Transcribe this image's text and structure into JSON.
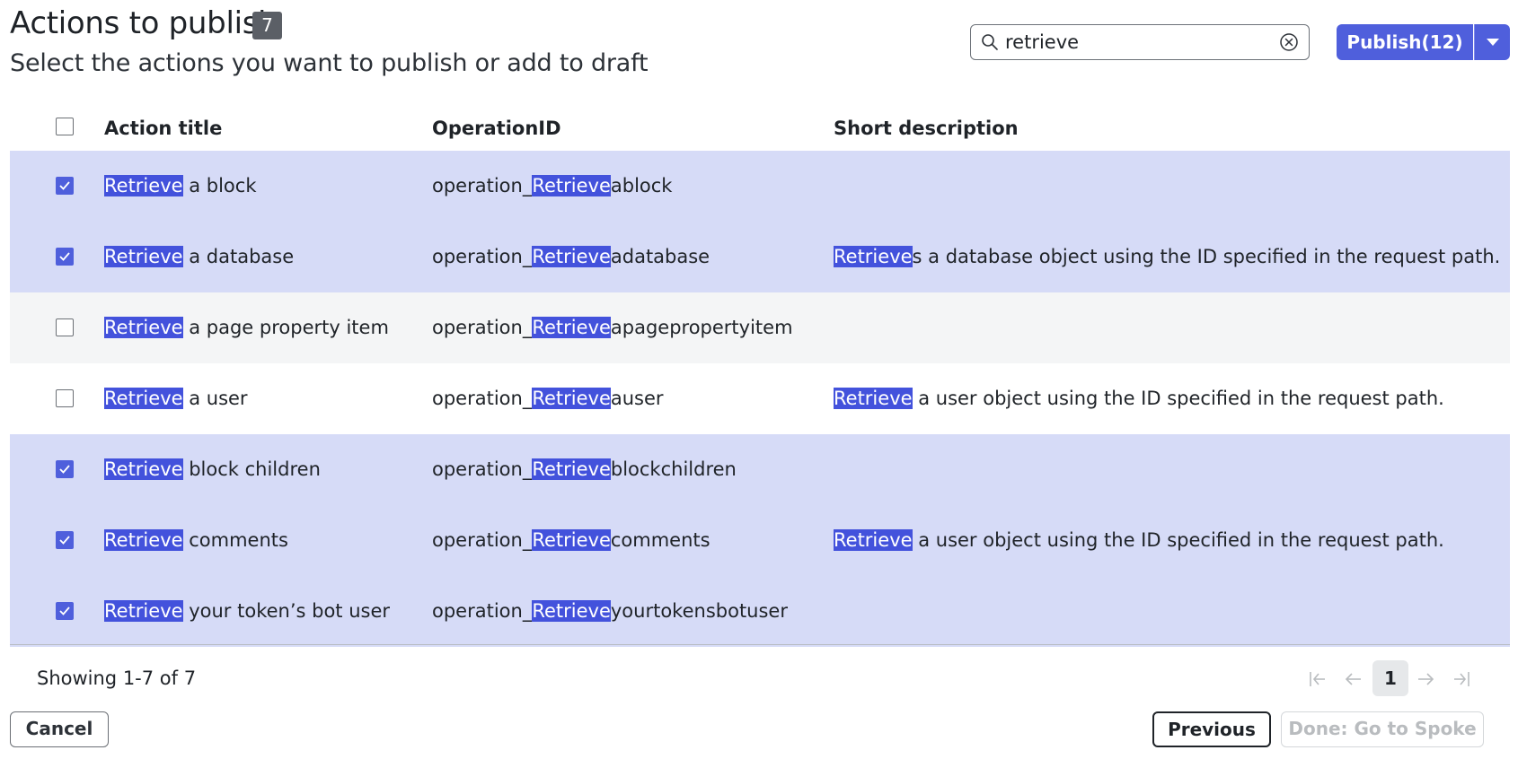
{
  "header": {
    "title": "Actions to publish",
    "count": "7",
    "subtitle": "Select the actions you want to publish or add to draft"
  },
  "search": {
    "value": "retrieve"
  },
  "publish": {
    "label": "Publish(12)"
  },
  "table": {
    "columns": {
      "title": "Action title",
      "operation": "OperationID",
      "description": "Short description"
    },
    "rows": [
      {
        "checked": true,
        "state": "selected",
        "title_hl": "Retrieve",
        "title_rest": " a block",
        "op_prefix": "operation_",
        "op_hl": "Retrieve",
        "op_rest": "ablock",
        "desc_hl": "",
        "desc_rest": ""
      },
      {
        "checked": true,
        "state": "selected",
        "title_hl": "Retrieve",
        "title_rest": " a database",
        "op_prefix": "operation_",
        "op_hl": "Retrieve",
        "op_rest": "adatabase",
        "desc_hl": "Retrieve",
        "desc_rest": "s a database object using the ID specified in the request path."
      },
      {
        "checked": false,
        "state": "hover",
        "title_hl": "Retrieve",
        "title_rest": " a page property item",
        "op_prefix": "operation_",
        "op_hl": "Retrieve",
        "op_rest": "apagepropertyitem",
        "desc_hl": "",
        "desc_rest": ""
      },
      {
        "checked": false,
        "state": "plain",
        "title_hl": "Retrieve",
        "title_rest": " a user",
        "op_prefix": "operation_",
        "op_hl": "Retrieve",
        "op_rest": "auser",
        "desc_hl": "Retrieve",
        "desc_rest": " a user object using the ID specified in the request path."
      },
      {
        "checked": true,
        "state": "selected",
        "title_hl": "Retrieve",
        "title_rest": " block children",
        "op_prefix": "operation_",
        "op_hl": "Retrieve",
        "op_rest": "blockchildren",
        "desc_hl": "",
        "desc_rest": ""
      },
      {
        "checked": true,
        "state": "selected",
        "title_hl": "Retrieve",
        "title_rest": " comments",
        "op_prefix": "operation_",
        "op_hl": "Retrieve",
        "op_rest": "comments",
        "desc_hl": "Retrieve",
        "desc_rest": " a user object using the ID specified in the request path."
      },
      {
        "checked": true,
        "state": "selected",
        "title_hl": "Retrieve",
        "title_rest": " your token’s bot user",
        "op_prefix": "operation_",
        "op_hl": "Retrieve",
        "op_rest": "yourtokensbotuser",
        "desc_hl": "",
        "desc_rest": ""
      }
    ]
  },
  "footer": {
    "showing": "Showing 1-7 of 7",
    "page": "1",
    "cancel": "Cancel",
    "previous": "Previous",
    "done": "Done: Go to Spoke"
  },
  "colors": {
    "accent": "#4f5fdc",
    "highlight": "#4352dc",
    "selected_row": "#d6dbf7",
    "hover_row": "#f4f5f6"
  },
  "icons": {
    "search": "search-icon",
    "clear": "clear-circle-icon",
    "caret": "chevron-down-icon",
    "check": "checkmark-icon",
    "first": "first-page-icon",
    "prev": "arrow-left-icon",
    "next": "arrow-right-icon",
    "last": "last-page-icon"
  }
}
